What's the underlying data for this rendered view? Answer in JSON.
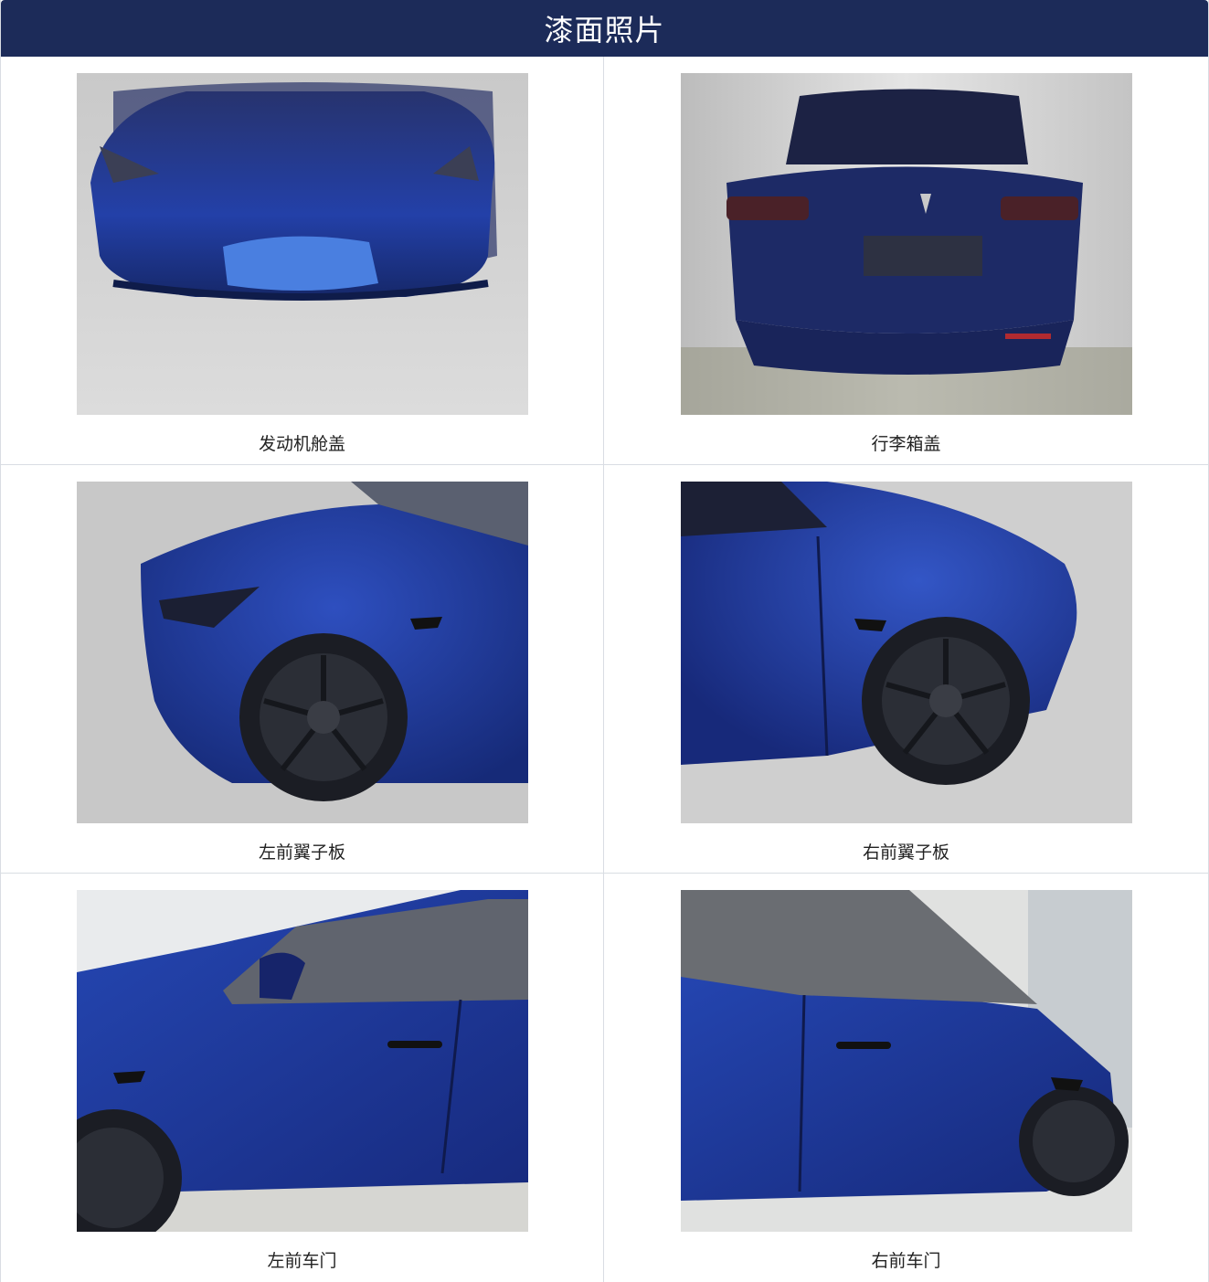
{
  "header": {
    "title": "漆面照片"
  },
  "photos": [
    {
      "caption": "发动机舱盖",
      "view": "hood"
    },
    {
      "caption": "行李箱盖",
      "view": "trunk"
    },
    {
      "caption": "左前翼子板",
      "view": "left-fender"
    },
    {
      "caption": "右前翼子板",
      "view": "right-fender"
    },
    {
      "caption": "左前车门",
      "view": "left-door"
    },
    {
      "caption": "右前车门",
      "view": "right-door"
    }
  ],
  "colors": {
    "header_bg": "#1c2b59",
    "paint_blue": "#1f3a96"
  }
}
